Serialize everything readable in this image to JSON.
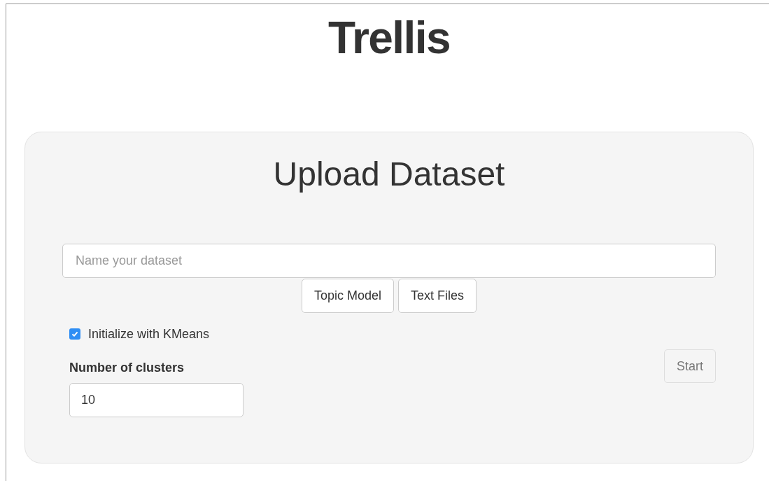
{
  "title": "Trellis",
  "panel": {
    "heading": "Upload Dataset",
    "name_field": {
      "placeholder": "Name your dataset"
    },
    "upload_buttons": [
      "Topic Model",
      "Text Files"
    ],
    "kmeans_checkbox": {
      "label": "Initialize with KMeans",
      "checked": true
    },
    "clusters": {
      "label": "Number of clusters",
      "value": "10"
    },
    "start_button": {
      "label": "Start",
      "disabled": true
    }
  }
}
